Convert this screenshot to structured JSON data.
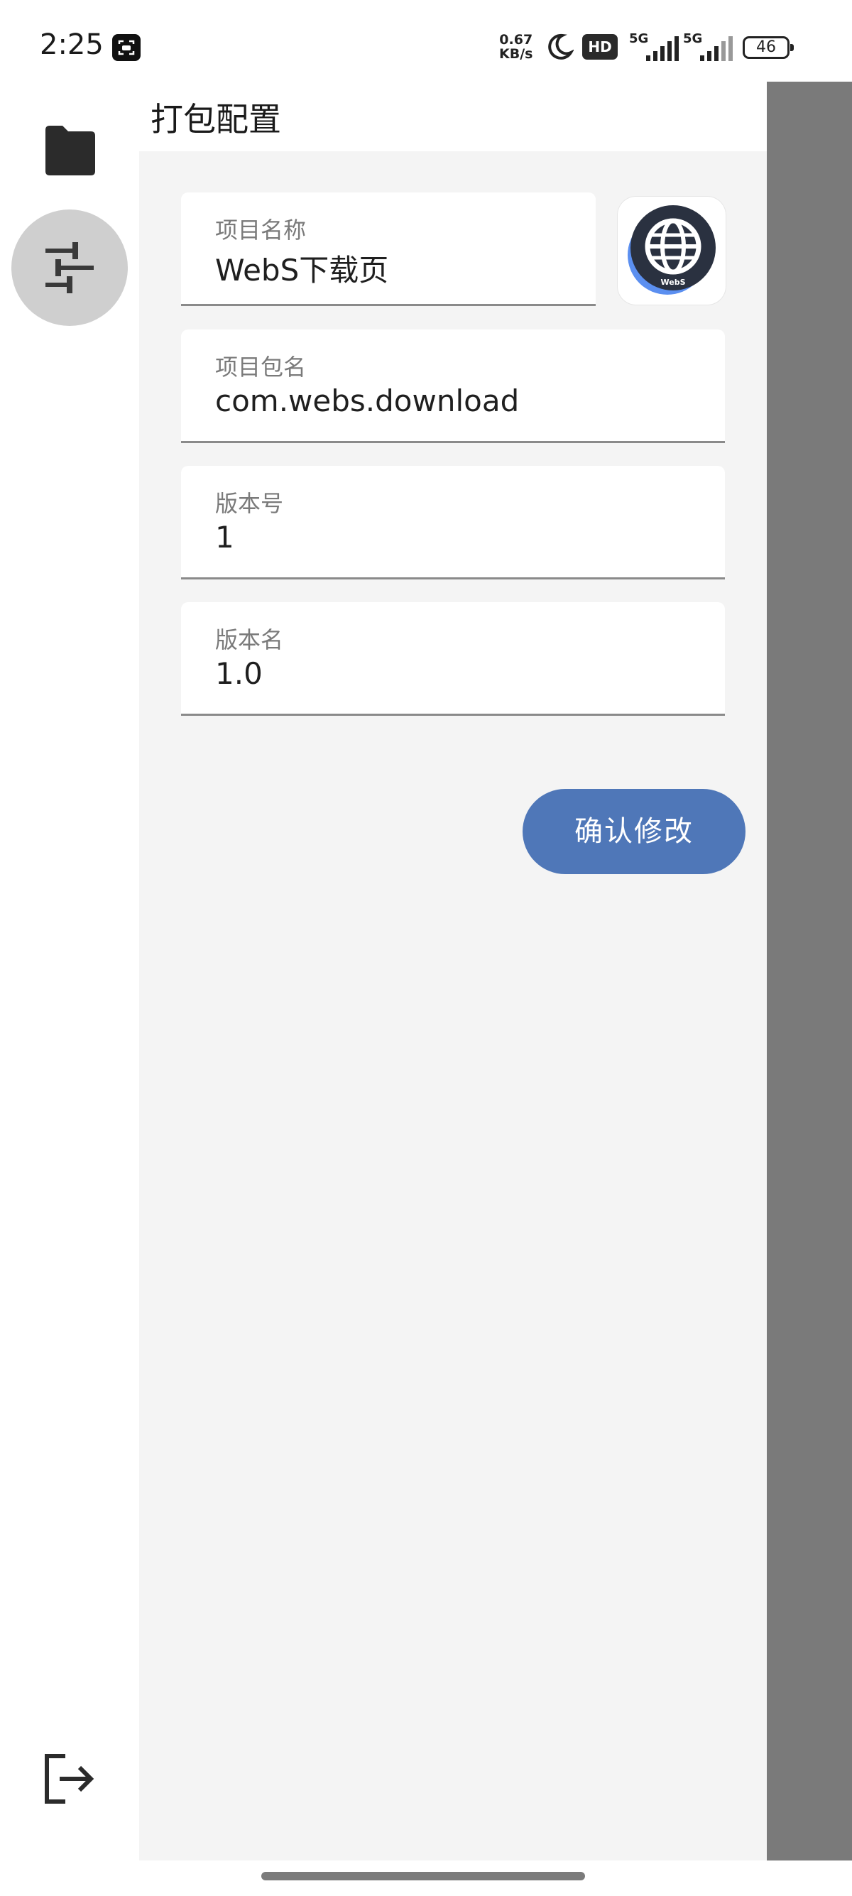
{
  "status_bar": {
    "time": "2:25",
    "net_speed_value": "0.67",
    "net_speed_unit": "KB/s",
    "hd_label": "HD",
    "network_1": "5G",
    "network_2": "5G",
    "battery": "46"
  },
  "page": {
    "title": "打包配置"
  },
  "form": {
    "project_name_label": "项目名称",
    "project_name_value": "WebS下载页",
    "package_name_label": "项目包名",
    "package_name_value": "com.webs.download",
    "version_code_label": "版本号",
    "version_code_value": "1",
    "version_name_label": "版本名",
    "version_name_value": "1.0",
    "app_icon_text": "WebS"
  },
  "actions": {
    "confirm_label": "确认修改"
  },
  "icons": {
    "nav_folder": "folder-icon",
    "nav_settings": "tune-icon",
    "nav_logout": "logout-icon",
    "app_icon": "globe-icon"
  },
  "colors": {
    "accent": "#4f77b8",
    "panel_bg": "#f4f4f4",
    "scrim": "#7a7a7a",
    "selected_nav_bg": "#cfcfcf"
  }
}
